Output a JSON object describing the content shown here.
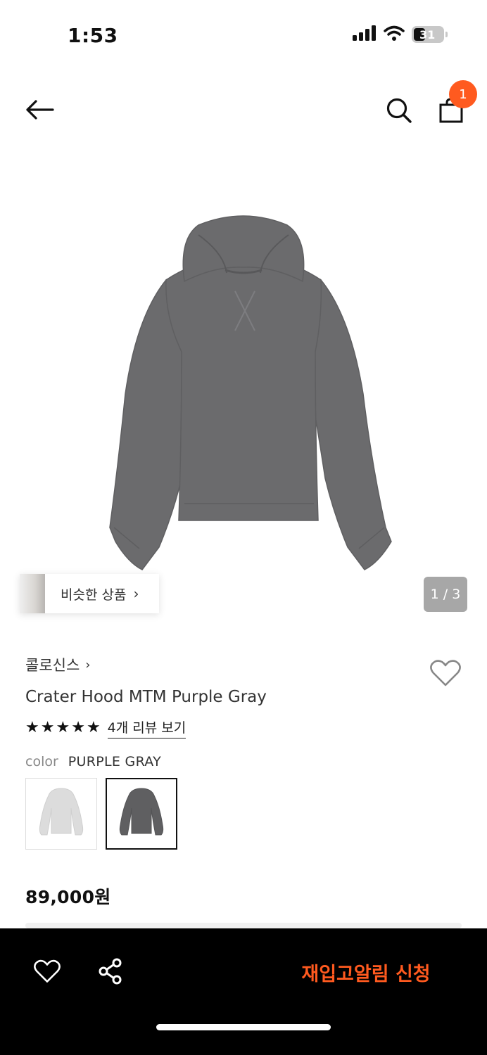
{
  "status_bar": {
    "time": "1:53",
    "battery_level": "31",
    "icons": [
      "cellular-signal-icon",
      "wifi-icon",
      "battery-icon"
    ]
  },
  "nav": {
    "icons": [
      "arrow-left-icon",
      "search-icon",
      "shopping-bag-icon"
    ],
    "cart_badge": "1"
  },
  "gallery": {
    "similar_label": "비슷한 상품",
    "similar_chevron": "›",
    "page_indicator": "1 / 3"
  },
  "product": {
    "brand": "콜로신스",
    "brand_chevron": "›",
    "name": "Crater Hood MTM Purple Gray",
    "rating_stars": 5,
    "review_link": "4개 리뷰 보기",
    "color_label": "color",
    "color_value": "PURPLE GRAY",
    "swatches": [
      {
        "color": "#dcdcdc",
        "selected": false
      },
      {
        "color": "#5f5f61",
        "selected": true
      }
    ],
    "price": "89,000원"
  },
  "bottom_bar": {
    "icons": [
      "heart-icon",
      "share-icon"
    ],
    "restock_label": "재입고알림 신청"
  },
  "colors": {
    "accent": "#ff5a1f",
    "hoodie": "#6b6b6d",
    "page_indicator_bg": "#a7a7a7"
  }
}
